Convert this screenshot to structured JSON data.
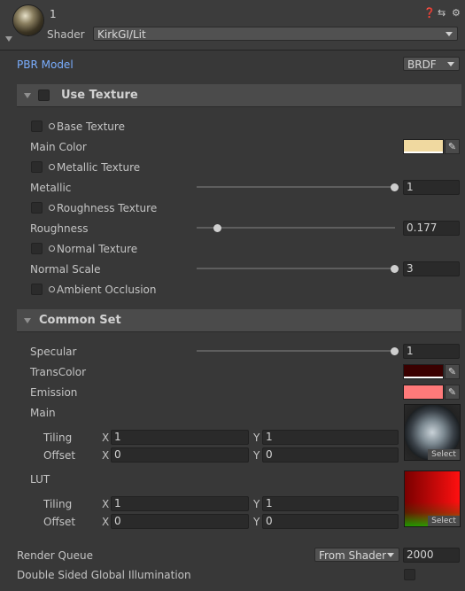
{
  "header": {
    "name": "1",
    "shader_label": "Shader",
    "shader_value": "KirkGI/Lit",
    "icons": [
      "help-icon",
      "preset-icon",
      "gear-icon"
    ]
  },
  "pbr_model": {
    "label": "PBR Model",
    "value": "BRDF",
    "label_color": "#7aaeff"
  },
  "use_texture": {
    "title": "Use Texture",
    "base_texture": "Base Texture",
    "main_color": {
      "label": "Main Color",
      "color": "#f0d9a0"
    },
    "metallic_texture": "Metallic Texture",
    "metallic": {
      "label": "Metallic",
      "value": "1",
      "fraction": 1.0
    },
    "roughness_texture": "Roughness Texture",
    "roughness": {
      "label": "Roughness",
      "value": "0.177",
      "fraction": 0.177
    },
    "normal_texture": "Normal Texture",
    "normal_scale": {
      "label": "Normal Scale",
      "value": "3",
      "fraction": 1.0
    },
    "ambient_occlusion": "Ambient Occlusion"
  },
  "common_set": {
    "title": "Common Set",
    "specular": {
      "label": "Specular",
      "value": "1",
      "fraction": 1.0
    },
    "trans_color": {
      "label": "TransColor",
      "color": "#3a0000"
    },
    "emission": {
      "label": "Emission",
      "color": "#ff7a7a"
    },
    "main": {
      "label": "Main",
      "tiling_label": "Tiling",
      "offset_label": "Offset",
      "tiling_x": "1",
      "tiling_y": "1",
      "offset_x": "0",
      "offset_y": "0",
      "select_label": "Select"
    },
    "lut": {
      "label": "LUT",
      "tiling_label": "Tiling",
      "offset_label": "Offset",
      "tiling_x": "1",
      "tiling_y": "1",
      "offset_x": "0",
      "offset_y": "0",
      "select_label": "Select"
    },
    "x_label": "X",
    "y_label": "Y"
  },
  "render_queue": {
    "label": "Render Queue",
    "mode": "From Shader",
    "value": "2000"
  },
  "double_sided_gi": {
    "label": "Double Sided Global Illumination"
  }
}
